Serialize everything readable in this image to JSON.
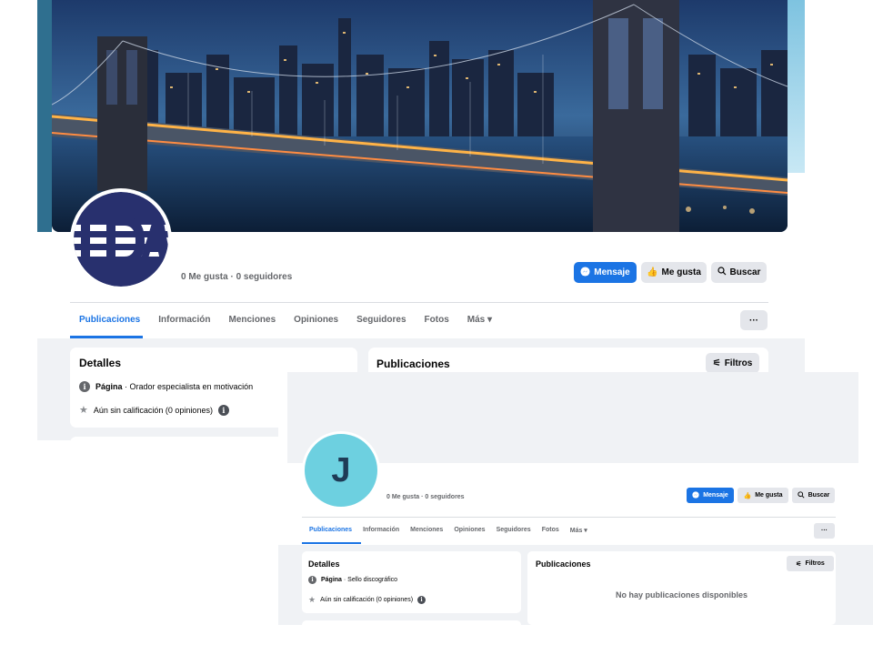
{
  "page_back": {
    "stats": "0 Me gusta · 0 seguidores",
    "buttons": {
      "message": "Mensaje",
      "like": "Me gusta",
      "search": "Buscar",
      "more": "···",
      "filters": "Filtros"
    },
    "tabs": [
      "Publicaciones",
      "Información",
      "Menciones",
      "Opiniones",
      "Seguidores",
      "Fotos",
      "Más ▾"
    ],
    "details": {
      "title": "Detalles",
      "type_label": "Página",
      "type_value": " · Orador especialista en motivación",
      "rating": "Aún sin calificación (0 opiniones)"
    },
    "posts_title": "Publicaciones"
  },
  "page_front": {
    "avatar_letter": "J",
    "stats": "0 Me gusta · 0 seguidores",
    "buttons": {
      "message": "Mensaje",
      "like": "Me gusta",
      "search": "Buscar",
      "more": "···",
      "filters": "Filtros"
    },
    "tabs": [
      "Publicaciones",
      "Información",
      "Menciones",
      "Opiniones",
      "Seguidores",
      "Fotos",
      "Más ▾"
    ],
    "details": {
      "title": "Detalles",
      "type_label": "Página",
      "type_value": " · Sello discográfico",
      "rating": "Aún sin calificación (0 opiniones)"
    },
    "posts_title": "Publicaciones",
    "empty_state": "No hay publicaciones disponibles"
  },
  "colors": {
    "accent": "#1b74e4",
    "feed_bg": "#f0f2f5",
    "avatar_j": "#6dd0e0"
  }
}
